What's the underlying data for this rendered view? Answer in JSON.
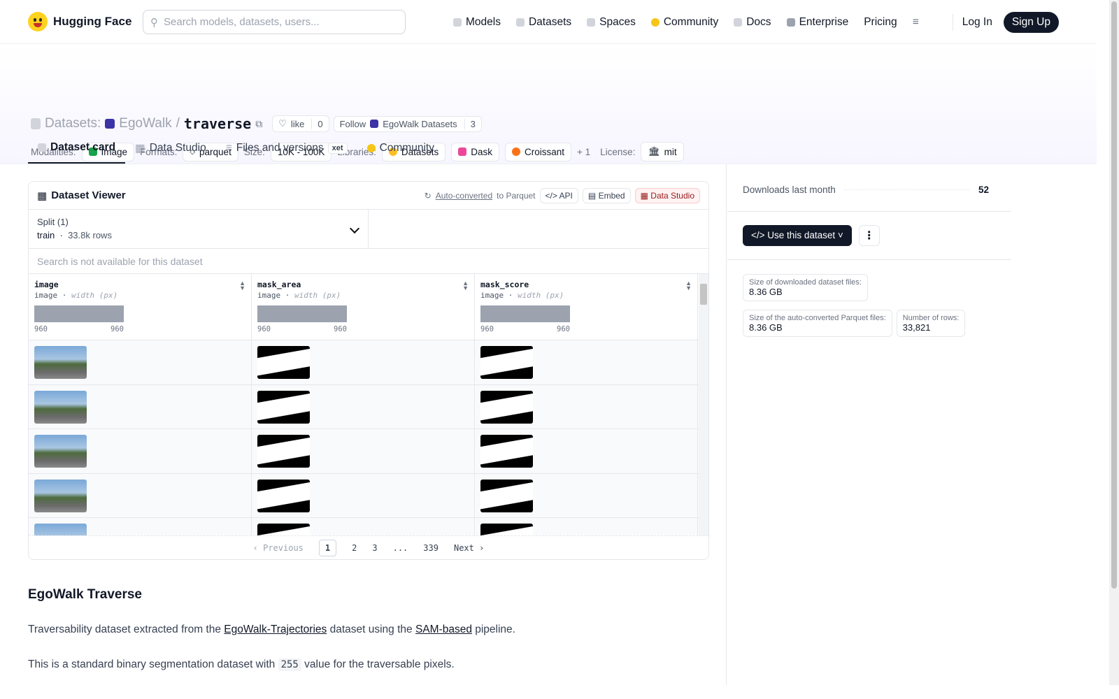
{
  "nav": {
    "brand": "Hugging Face",
    "search_placeholder": "Search models, datasets, users...",
    "links": [
      "Models",
      "Datasets",
      "Spaces",
      "Community",
      "Docs",
      "Enterprise",
      "Pricing"
    ],
    "login": "Log In",
    "signup": "Sign Up"
  },
  "header": {
    "prefix": "Datasets:",
    "org": "EgoWalk",
    "repo": "traverse",
    "like_label": "like",
    "like_count": "0",
    "follow_label": "Follow",
    "follow_org": "EgoWalk Datasets",
    "follow_count": "3",
    "modalities_label": "Modalities:",
    "modality": "Image",
    "formats_label": "Formats:",
    "format": "parquet",
    "size_label": "Size:",
    "size": "10K - 100K",
    "libraries_label": "Libraries:",
    "libraries": [
      "Datasets",
      "Dask",
      "Croissant"
    ],
    "libraries_more": "+ 1",
    "license_label": "License:",
    "license": "mit"
  },
  "tabs": [
    "Dataset card",
    "Data Studio",
    "Files and versions",
    "Community"
  ],
  "tab_badge": "xet",
  "viewer": {
    "title": "Dataset Viewer",
    "auto_link": "Auto-converted",
    "auto_suffix": "to Parquet",
    "api": "API",
    "embed": "Embed",
    "studio": "Data Studio",
    "split_label": "Split (1)",
    "split_value": "train",
    "split_rows": "33.8k rows",
    "search_placeholder": "Search is not available for this dataset",
    "columns": [
      {
        "name": "image",
        "type": "image",
        "sub": "width (px)",
        "min": "960",
        "max": "960"
      },
      {
        "name": "mask_area",
        "type": "image",
        "sub": "width (px)",
        "min": "960",
        "max": "960"
      },
      {
        "name": "mask_score",
        "type": "image",
        "sub": "width (px)",
        "min": "960",
        "max": "960"
      }
    ],
    "pager": {
      "prev": "Previous",
      "pages": [
        "1",
        "2",
        "3",
        "...",
        "339"
      ],
      "next": "Next"
    }
  },
  "sidebar": {
    "downloads_label": "Downloads last month",
    "downloads": "52",
    "use_button": "Use this dataset",
    "stats": [
      {
        "k": "Size of downloaded dataset files:",
        "v": "8.36 GB"
      },
      {
        "k": "Size of the auto-converted Parquet files:",
        "v": "8.36 GB"
      },
      {
        "k": "Number of rows:",
        "v": "33,821"
      }
    ]
  },
  "card": {
    "heading": "EgoWalk Traverse",
    "p1_a": "Traversability dataset extracted from the ",
    "p1_link1": "EgoWalk-Trajectories",
    "p1_b": " dataset using the ",
    "p1_link2": "SAM-based",
    "p1_c": " pipeline.",
    "p2_a": "This is a standard binary segmentation dataset with ",
    "p2_code": "255",
    "p2_b": " value for the traversable pixels."
  }
}
